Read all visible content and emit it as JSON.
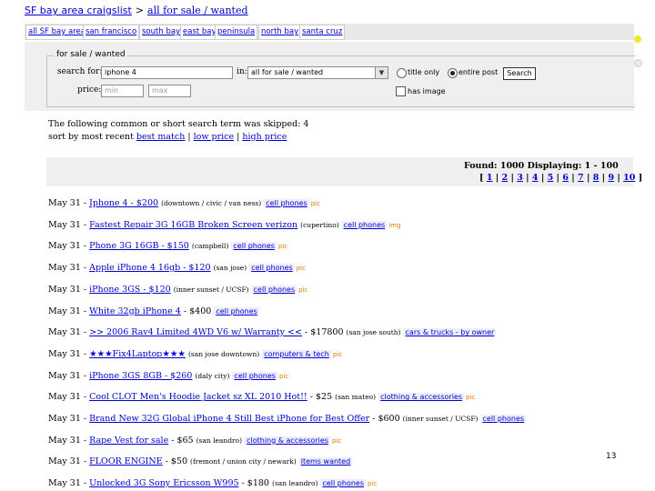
{
  "breadcrumb": {
    "site": "SF bay area craigslist",
    "separator": ">",
    "section": "all for sale / wanted"
  },
  "nav_tabs": [
    "all SF bay area",
    "san francisco",
    "south bay",
    "east bay",
    "peninsula",
    "north bay",
    "santa cruz"
  ],
  "search_form": {
    "legend": "for sale / wanted",
    "search_for_label": "search for:",
    "search_value": "iphone 4",
    "in_label": "in:",
    "category_selected": "all for sale / wanted",
    "title_only_label": "title only",
    "entire_post_label": "entire post",
    "selected_scope": "entire post",
    "search_button": "Search",
    "price_label": "price:",
    "min_placeholder": "min",
    "max_placeholder": "max",
    "has_image_label": "has image",
    "has_image_checked": false
  },
  "notice": {
    "skipped": "The following common or short search term was skipped: 4",
    "sort_prefix": "sort by most recent",
    "sort_best": "best match",
    "sort_low": "low price",
    "sort_high": "high price"
  },
  "results_header": {
    "found": "Found: 1000 Displaying: 1 - 100",
    "pages": [
      "1",
      "2",
      "3",
      "4",
      "5",
      "6",
      "7",
      "8",
      "9",
      "10"
    ]
  },
  "listings": [
    {
      "date": "May 31",
      "title": "Iphone 4 - $200",
      "location": "(downtown / civic / van ness)",
      "category": "cell phones",
      "pic": "pic"
    },
    {
      "date": "May 31",
      "title": "Fastest Repair 3G 16GB Broken Screen verizon",
      "location": "(cupertino)",
      "category": "cell phones",
      "pic": "img"
    },
    {
      "date": "May 31",
      "title": "Phone 3G 16GB - $150",
      "location": "(campbell)",
      "category": "cell phones",
      "pic": "pic"
    },
    {
      "date": "May 31",
      "title": "Apple iPhone 4 16gb - $120",
      "location": "(san jose)",
      "category": "cell phones",
      "pic": "pic"
    },
    {
      "date": "May 31",
      "title": "iPhone 3GS - $120",
      "location": "(inner sunset / UCSF)",
      "category": "cell phones",
      "pic": "pic"
    },
    {
      "date": "May 31",
      "title": "White 32gb iPhone 4",
      "price": "$400",
      "location": "",
      "category": "cell phones",
      "pic": ""
    },
    {
      "date": "May 31",
      "title": ">> 2006 Rav4 Limited 4WD V6 w/ Warranty <<",
      "price": "$17800",
      "location": "(san jose south)",
      "category": "cars & trucks - by owner",
      "pic": ""
    },
    {
      "date": "May 31",
      "title": "★★★Fix4Laptop★★★",
      "location": "(san jose downtown)",
      "category": "computers & tech",
      "pic": "pic"
    },
    {
      "date": "May 31",
      "title": "iPhone 3GS 8GB - $260",
      "location": "(daly city)",
      "category": "cell phones",
      "pic": "pic"
    },
    {
      "date": "May 31",
      "title": "Cool CLOT Men's Hoodie Jacket sz XL 2010 Hot!!",
      "price": "$25",
      "location": "(san mateo)",
      "category": "clothing & accessories",
      "pic": "pic"
    },
    {
      "date": "May 31",
      "title": "Brand New 32G Global iPhone 4 Still Best iPhone for Best Offer",
      "price": "$600",
      "location": "(inner sunset / UCSF)",
      "category": "cell phones",
      "pic": ""
    },
    {
      "date": "May 31",
      "title": "Rape Vest for sale",
      "price": "$65",
      "location": "(san leandro)",
      "category": "clothing & accessories",
      "pic": "pic"
    },
    {
      "date": "May 31",
      "title": "FLOOR ENGINE",
      "price": "$50",
      "location": "(fremont / union city / newark)",
      "category": "items wanted",
      "pic": ""
    },
    {
      "date": "May 31",
      "title": "Unlocked 3G Sony Ericsson W995",
      "price": "$180",
      "location": "(san leandro)",
      "category": "cell phones",
      "pic": "pic"
    }
  ],
  "slide_number": "13"
}
